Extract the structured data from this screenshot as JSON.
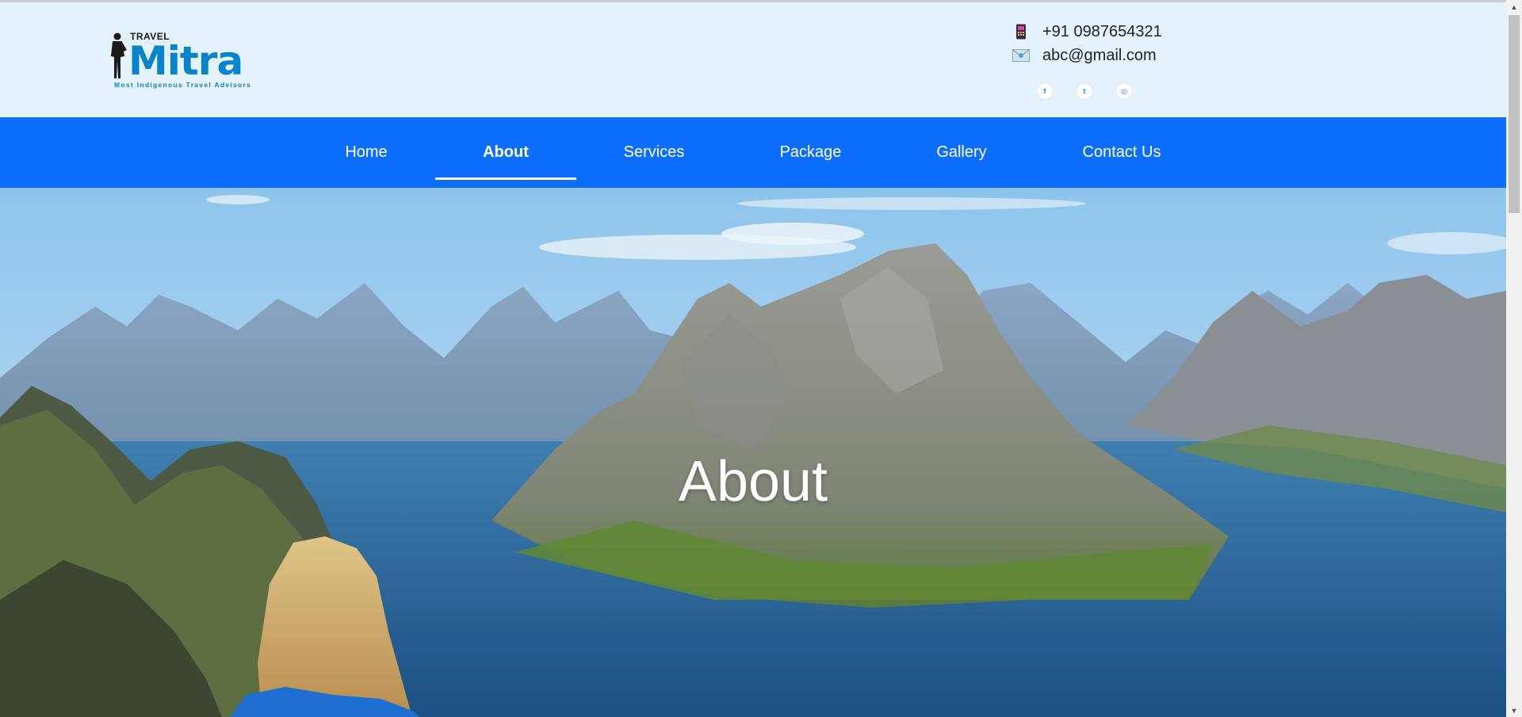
{
  "logo": {
    "travel": "TRAVEL",
    "brand": "Mitra",
    "tagline": "Most Indigenous Travel Advisors"
  },
  "contact": {
    "phone": "+91 0987654321",
    "email": "abc@gmail.com",
    "phone_icon": "mobile-phone-icon",
    "email_icon": "envelope-icon"
  },
  "socials": [
    {
      "icon": "facebook-icon",
      "glyph": "f"
    },
    {
      "icon": "twitter-icon",
      "glyph": "t"
    },
    {
      "icon": "instagram-icon",
      "glyph": "◎"
    }
  ],
  "nav": {
    "items": [
      {
        "label": "Home"
      },
      {
        "label": "About",
        "active": true
      },
      {
        "label": "Services"
      },
      {
        "label": "Package"
      },
      {
        "label": "Gallery"
      },
      {
        "label": "Contact Us"
      }
    ]
  },
  "hero": {
    "title": "About",
    "image": "mountain-fjord-landscape"
  },
  "colors": {
    "header_bg": "#e3f2fd",
    "nav_bg": "#0d6efd",
    "brand_blue": "#0a84c8"
  }
}
